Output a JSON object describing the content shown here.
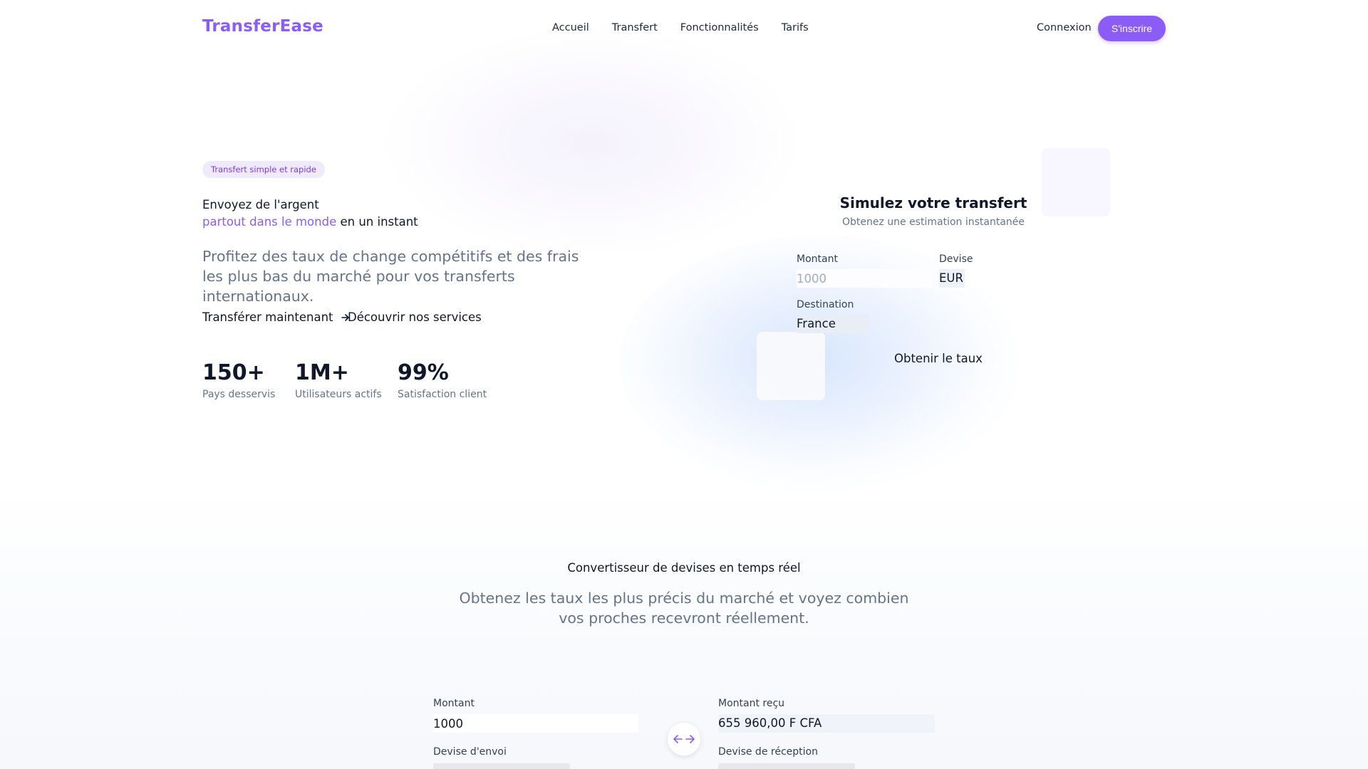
{
  "nav": {
    "logo": "TransferEase",
    "links": [
      "Accueil",
      "Transfert",
      "Fonctionnalités",
      "Tarifs"
    ],
    "login": "Connexion",
    "signup": "S'inscrire"
  },
  "hero": {
    "badge": "Transfert simple et rapide",
    "title_line1": "Envoyez de l'argent",
    "title_accent": "partout dans le monde",
    "title_line2_rest": " en un instant",
    "subtitle": "Profitez des taux de change compétitifs et des frais les plus bas du marché pour vos transferts internationaux.",
    "cta_primary": "Transférer maintenant",
    "cta_secondary": "Découvrir nos services",
    "stats": [
      {
        "value": "150+",
        "label": "Pays desservis"
      },
      {
        "value": "1M+",
        "label": "Utilisateurs actifs"
      },
      {
        "value": "99%",
        "label": "Satisfaction client"
      }
    ]
  },
  "simulator": {
    "title": "Simulez votre transfert",
    "subtitle": "Obtenez une estimation instantanée",
    "amount_label": "Montant",
    "amount_placeholder": "1000",
    "currency_label": "Devise",
    "currency_value": "EUR",
    "destination_label": "Destination",
    "destination_value": "France",
    "button": "Obtenir le taux"
  },
  "converter": {
    "title": "Convertisseur de devises en temps réel",
    "subtitle": "Obtenez les taux les plus précis du marché et voyez combien vos proches recevront réellement.",
    "amount_label": "Montant",
    "amount_value": "1000",
    "received_label": "Montant reçu",
    "received_value": "655 960,00 F CFA",
    "send_currency_label": "Devise d'envoi",
    "receive_currency_label": "Devise de réception"
  },
  "colors": {
    "brand": "#8b5cf6",
    "text": "#0f172a",
    "muted": "#64748b"
  }
}
